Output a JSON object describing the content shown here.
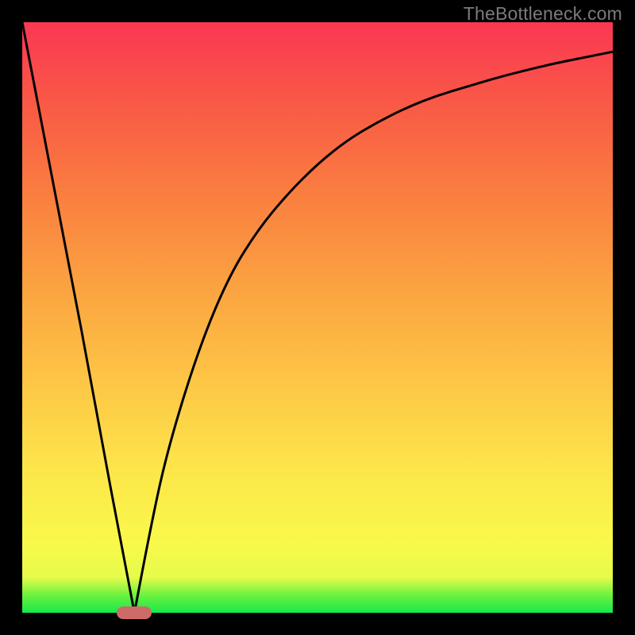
{
  "watermark": "TheBottleneck.com",
  "colors": {
    "background": "#000000",
    "curve": "#000000",
    "marker": "#cc6b68",
    "gradient_top": "#fa3753",
    "gradient_bottom": "#17e84a"
  },
  "chart_data": {
    "type": "line",
    "title": "",
    "xlabel": "",
    "ylabel": "",
    "xlim": [
      0,
      100
    ],
    "ylim": [
      0,
      100
    ],
    "grid": false,
    "legend": false,
    "vertex": {
      "x": 19,
      "y": 0
    },
    "marker": {
      "x": 19,
      "y": 0,
      "shape": "rounded-pill",
      "color": "#cc6b68"
    },
    "series": [
      {
        "name": "left-branch",
        "description": "steep descending line from top-left toward vertex",
        "x": [
          0,
          5,
          10,
          15,
          19
        ],
        "values": [
          100,
          74,
          48,
          21,
          0
        ]
      },
      {
        "name": "right-branch",
        "description": "concave curve rising from vertex and flattening toward top-right",
        "x": [
          19,
          22,
          25,
          30,
          35,
          40,
          45,
          50,
          55,
          60,
          65,
          70,
          75,
          80,
          85,
          90,
          95,
          100
        ],
        "values": [
          0,
          16,
          29,
          45,
          57,
          65,
          71,
          76,
          80,
          83,
          85.5,
          87.5,
          89,
          90.5,
          91.8,
          93,
          94,
          95
        ]
      }
    ]
  }
}
